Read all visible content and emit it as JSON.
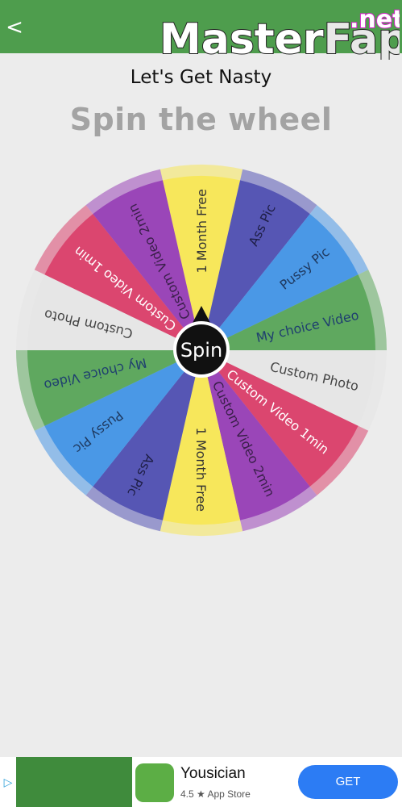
{
  "header": {
    "back_glyph": "<",
    "watermark": {
      "part1": "Master",
      "part2": "Fap",
      "part3": ".net"
    },
    "colors": {
      "bar": "#4e9d4d"
    }
  },
  "page": {
    "subtitle": "Let's Get Nasty",
    "title": "Spin the wheel"
  },
  "wheel": {
    "spin_label": "Spin",
    "segments": [
      {
        "label": "1 Month Free",
        "color": "#f7e75b",
        "text_color": "#333333"
      },
      {
        "label": "Ass Pic",
        "color": "#5656b4",
        "text_color": "#1e1e46"
      },
      {
        "label": "Pussy Pic",
        "color": "#4a98e6",
        "text_color": "#1f3a61"
      },
      {
        "label": "My choice Video",
        "color": "#5fa85f",
        "text_color": "#1f3f6f"
      },
      {
        "label": "Custom Photo",
        "color": "#e6e6e6",
        "text_color": "#444444"
      },
      {
        "label": "Custom Video 1min",
        "color": "#db466f",
        "text_color": "#ffffff"
      },
      {
        "label": "Custom Video 2min",
        "color": "#9a46b8",
        "text_color": "#3a1f4a"
      },
      {
        "label": "1 Month Free",
        "color": "#f7e75b",
        "text_color": "#333333"
      },
      {
        "label": "Ass Pic",
        "color": "#5656b4",
        "text_color": "#1e1e46"
      },
      {
        "label": "Pussy Pic",
        "color": "#4a98e6",
        "text_color": "#1f3a61"
      },
      {
        "label": "My choice Video",
        "color": "#5fa85f",
        "text_color": "#1f3f6f"
      },
      {
        "label": "Custom Photo",
        "color": "#e6e6e6",
        "text_color": "#444444"
      },
      {
        "label": "Custom Video 1min",
        "color": "#db466f",
        "text_color": "#ffffff"
      },
      {
        "label": "Custom Video 2min",
        "color": "#9a46b8",
        "text_color": "#3a1f4a"
      }
    ]
  },
  "ad": {
    "app_name": "Yousician",
    "rating": "4.5 ★ App Store",
    "cta": "GET",
    "choices_glyph": "▷"
  }
}
